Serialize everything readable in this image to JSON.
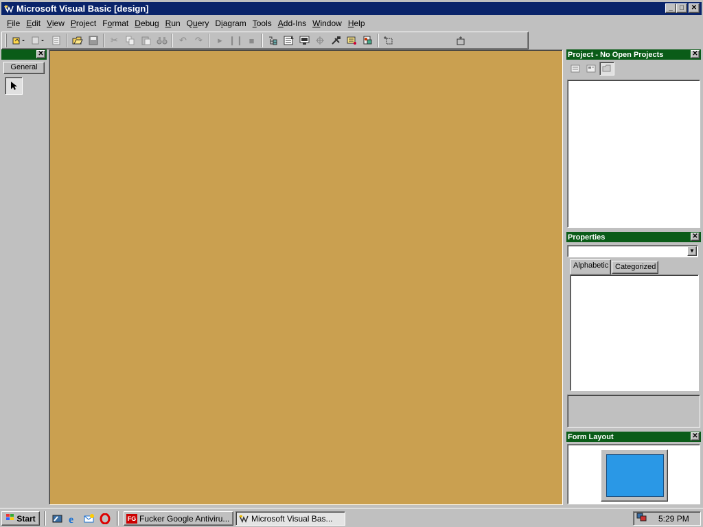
{
  "window": {
    "title": "Microsoft Visual Basic [design]",
    "min_label": "_",
    "max_label": "□",
    "close_label": "✕"
  },
  "menu": {
    "items": [
      {
        "underline": "F",
        "rest": "ile"
      },
      {
        "underline": "E",
        "rest": "dit"
      },
      {
        "underline": "V",
        "rest": "iew"
      },
      {
        "underline": "P",
        "rest": "roject"
      },
      {
        "underline": "o",
        "pre": "F",
        "rest": "rmat"
      },
      {
        "underline": "D",
        "rest": "ebug"
      },
      {
        "underline": "R",
        "rest": "un"
      },
      {
        "underline": "u",
        "pre": "Q",
        "rest": "ery"
      },
      {
        "underline": "i",
        "pre": "D",
        "rest": "agram"
      },
      {
        "underline": "T",
        "rest": "ools"
      },
      {
        "underline": "A",
        "rest": "dd-Ins"
      },
      {
        "underline": "W",
        "rest": "indow"
      },
      {
        "underline": "H",
        "rest": "elp"
      }
    ]
  },
  "toolbox": {
    "close_label": "✕",
    "tab_label": "General"
  },
  "project": {
    "title": "Project - No Open Projects",
    "close_label": "✕"
  },
  "properties": {
    "title": "Properties",
    "close_label": "✕",
    "tab_alphabetic": "Alphabetic",
    "tab_categorized": "Categorized"
  },
  "form_layout": {
    "title": "Form Layout",
    "close_label": "✕"
  },
  "taskbar": {
    "start_label": "Start",
    "task1_icon_text": "FG",
    "task1_label": "Fucker Google Antiviru...",
    "task2_label": "Microsoft Visual Bas...",
    "clock": "5:29 PM"
  },
  "colors": {
    "title_active": "#0a246a",
    "panel_title": "#0a5c18",
    "mdi_background": "#caa050",
    "form_layout_screen": "#2a98e6"
  }
}
